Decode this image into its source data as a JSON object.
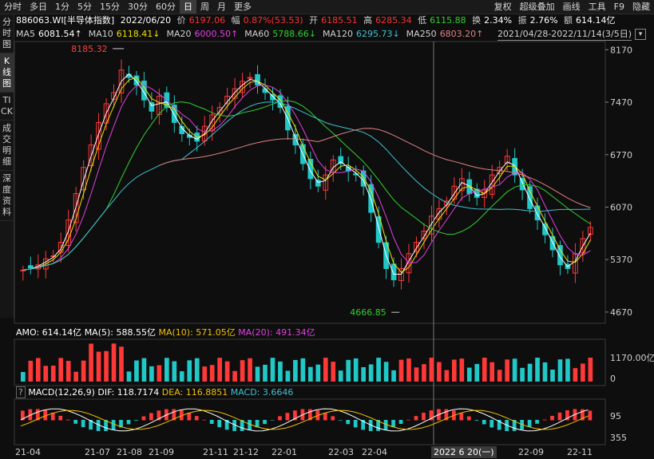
{
  "toolbar": {
    "left": [
      "分时",
      "多日",
      "1分",
      "5分",
      "15分",
      "30分",
      "60分",
      "日",
      "周",
      "月",
      "更多"
    ],
    "active": "日",
    "right": [
      "复权",
      "超级叠加",
      "画线",
      "工具",
      "F9",
      "隐藏"
    ]
  },
  "sidebar": [
    "分时图",
    "K线图",
    "TICK",
    "成交明细",
    "深度资料"
  ],
  "header": {
    "code": "886063.WI[半导体指数]",
    "date": "2022/06/20",
    "price_label": "价",
    "price": "6197.06",
    "change_label": "幅",
    "change": "0.87%(53.53)",
    "open_label": "开",
    "open": "6185.51",
    "high_label": "高",
    "high": "6285.34",
    "low_label": "低",
    "low": "6115.88",
    "turnover_label": "换",
    "turnover": "2.34%",
    "amplitude_label": "振",
    "amplitude": "2.76%",
    "amount_label": "额",
    "amount": "614.14亿"
  },
  "ma": [
    {
      "label": "MA5",
      "value": "6081.54↑",
      "color": "#ffffff"
    },
    {
      "label": "MA10",
      "value": "6118.41↓",
      "color": "#f0e000"
    },
    {
      "label": "MA20",
      "value": "6000.50↑",
      "color": "#e040e0"
    },
    {
      "label": "MA60",
      "value": "5788.66↓",
      "color": "#30d030"
    },
    {
      "label": "MA120",
      "value": "6295.73↓",
      "color": "#40c0d0"
    },
    {
      "label": "MA250",
      "value": "6803.20↑",
      "color": "#e08080"
    }
  ],
  "range": "2021/04/28-2022/11/14(3/5日)",
  "amo": {
    "label": "AMO: 614.14亿",
    "ma5": "MA(5): 588.55亿",
    "ma10": "MA(10): 571.05亿",
    "ma20": "MA(20): 491.34亿"
  },
  "macd": {
    "q": "?",
    "label": "MACD(12,26,9)",
    "dif": "DIF: 118.7174",
    "dea": "DEA: 116.8851",
    "macd": "MACD: 3.6646"
  },
  "cursor_date": "2022 6 20(一)",
  "chart_data": {
    "type": "candlestick",
    "title": "886063.WI[半导体指数]",
    "y_ticks": [
      "8170",
      "7470",
      "6770",
      "6070",
      "5370",
      "4670"
    ],
    "ylim": [
      4520,
      8280
    ],
    "annotations": {
      "high": "8185.32",
      "low": "4666.85"
    },
    "x_ticks": [
      "21-04",
      "21-07",
      "21-08",
      "21-09",
      "21-11",
      "21-12",
      "22-01",
      "22-03",
      "22-04",
      "22-09",
      "22-11"
    ],
    "close_series": [
      5230,
      5260,
      5300,
      5380,
      5420,
      5600,
      5900,
      6250,
      6600,
      6900,
      7200,
      7450,
      7600,
      7900,
      7800,
      7700,
      7500,
      7350,
      7550,
      7400,
      7200,
      7050,
      7000,
      6950,
      7150,
      7300,
      7400,
      7550,
      7650,
      7750,
      7800,
      7700,
      7600,
      7500,
      7400,
      7100,
      6900,
      6650,
      6450,
      6350,
      6500,
      6700,
      6650,
      6550,
      6500,
      6350,
      6000,
      5600,
      5250,
      5100,
      5250,
      5450,
      5600,
      5750,
      5950,
      6050,
      6150,
      6350,
      6450,
      6250,
      6200,
      6300,
      6500,
      6600,
      6750,
      6500,
      6300,
      6050,
      5900,
      5700,
      5500,
      5300,
      5250,
      5450,
      5650,
      5800
    ],
    "volume_axis": [
      "1170.00亿",
      "0"
    ],
    "macd_axis": [
      "95",
      "355"
    ]
  }
}
